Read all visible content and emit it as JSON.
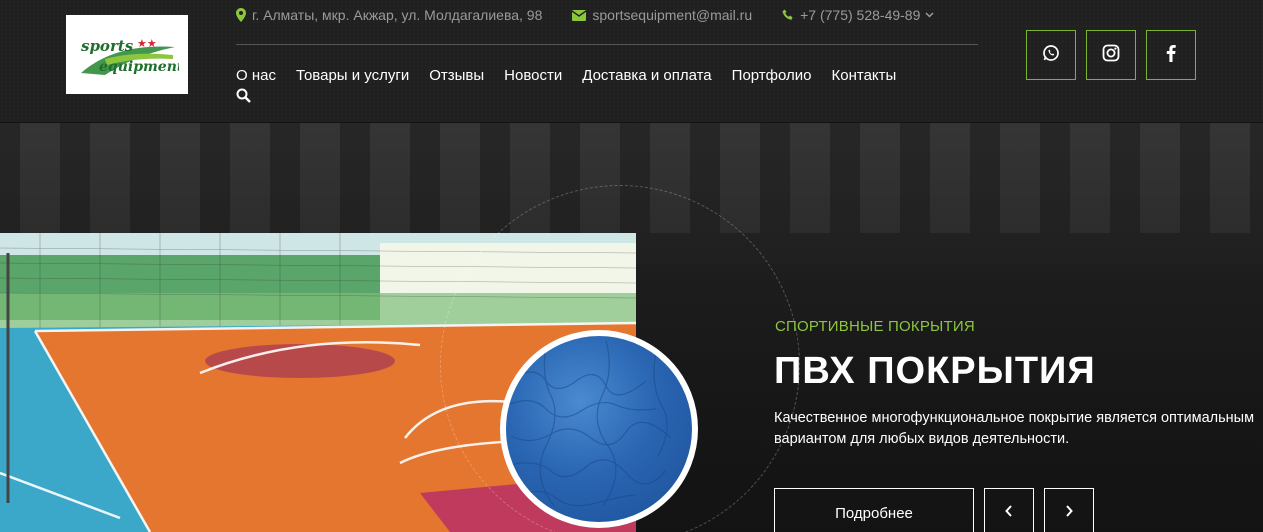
{
  "header": {
    "logo": {
      "line1": "sports",
      "line2": "equipment"
    },
    "contacts": {
      "address": "г. Алматы, мкр. Акжар, ул. Молдагалиева, 98",
      "email": "sportsequipment@mail.ru",
      "phone": "+7 (775) 528-49-89"
    },
    "nav": [
      {
        "label": "О нас"
      },
      {
        "label": "Товары и услуги"
      },
      {
        "label": "Отзывы"
      },
      {
        "label": "Новости"
      },
      {
        "label": "Доставка и оплата"
      },
      {
        "label": "Портфолио"
      },
      {
        "label": "Контакты"
      }
    ],
    "social": [
      "whatsapp-icon",
      "instagram-icon",
      "facebook-icon"
    ]
  },
  "slide": {
    "category": "СПОРТИВНЫЕ ПОКРЫТИЯ",
    "title": "ПВХ ПОКРЫТИЯ",
    "description_line1": "Качественное многофункциональное покрытие является оптимальным",
    "description_line2": "вариантом для любых видов деятельности.",
    "more_label": "Подробнее"
  },
  "colors": {
    "accent": "#8cc63f",
    "border_accent": "#7ab231",
    "background": "#202020"
  }
}
